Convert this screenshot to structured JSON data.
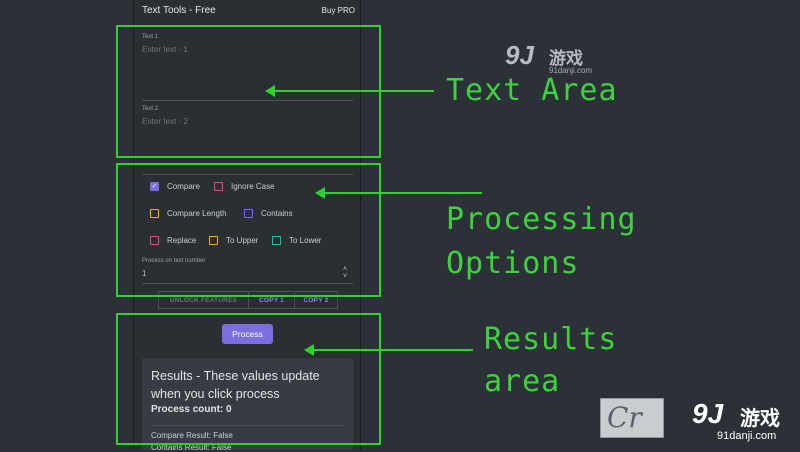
{
  "app": {
    "title": "Text Tools - Free",
    "buy_pro": "Buy PRO"
  },
  "text_area": {
    "text1": {
      "label": "Text 1",
      "placeholder": "Enter text - 1"
    },
    "text2": {
      "label": "Text 2",
      "placeholder": "Enter text - 2"
    }
  },
  "options": [
    {
      "label": "Compare",
      "checked": true,
      "color": "#7b6fe0"
    },
    {
      "label": "Ignore Case",
      "checked": false,
      "color": "#e0507a"
    },
    {
      "label": "Compare Length",
      "checked": false,
      "color": "#f0b020"
    },
    {
      "label": "Contains",
      "checked": false,
      "color": "#7b6fe0"
    },
    {
      "label": "Replace",
      "checked": false,
      "color": "#e0507a"
    },
    {
      "label": "To Upper",
      "checked": false,
      "color": "#f0b020"
    },
    {
      "label": "To Lower",
      "checked": false,
      "color": "#2cc0a0"
    }
  ],
  "process_on": {
    "label": "Process on text number",
    "value": "1"
  },
  "buttons": {
    "unlock": "UNLOCK FEATURES",
    "copy1": "COPY 1",
    "copy2": "COPY 2",
    "process": "Process"
  },
  "results": {
    "title": "Results - These values update when you click process",
    "count": "Process count: 0",
    "compare": "Compare Result: False",
    "contains": "Contains Result: False"
  },
  "annotations": {
    "text_area": "Text Area",
    "processing": [
      "Processing",
      "Options"
    ],
    "results": [
      "Results",
      "area"
    ]
  },
  "watermark": {
    "logo": "9J",
    "name": "游戏",
    "url": "91danji.com",
    "box_text": "Cr"
  },
  "colors": {
    "annotation": "#2fd12f",
    "accent": "#7b6fe0"
  }
}
